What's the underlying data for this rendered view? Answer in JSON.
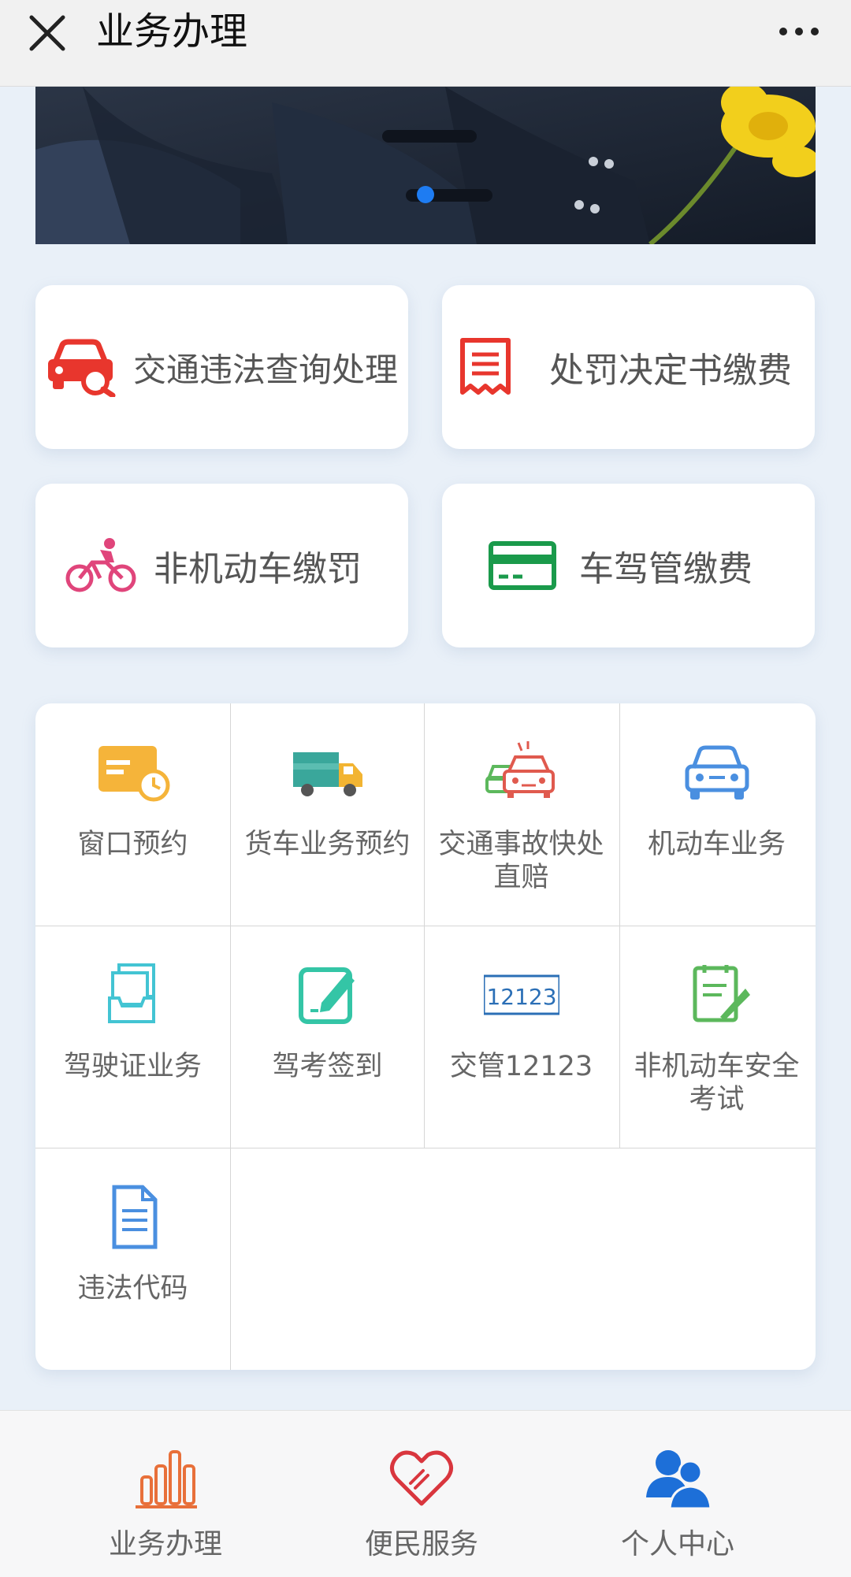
{
  "header": {
    "title": "业务办理",
    "close_icon": "close-icon",
    "more_icon": "more-icon"
  },
  "banner": {
    "carousel_pages": 1,
    "active_page": 1
  },
  "quick_cards": [
    {
      "label": "交通违法查询处理",
      "icon": "car-search-icon",
      "color": "#e8362d"
    },
    {
      "label": "处罚决定书缴费",
      "icon": "receipt-icon",
      "color": "#e8362d"
    },
    {
      "label": "非机动车缴罚",
      "icon": "bicycle-icon",
      "color": "#e0457b"
    },
    {
      "label": "车驾管缴费",
      "icon": "bank-card-icon",
      "color": "#1a9a4b"
    }
  ],
  "services": [
    {
      "label": "窗口预约",
      "icon": "window-appointment-icon"
    },
    {
      "label": "货车业务预约",
      "icon": "truck-icon"
    },
    {
      "label": "交通事故快处直赔",
      "icon": "accident-icon"
    },
    {
      "label": "机动车业务",
      "icon": "motor-vehicle-icon"
    },
    {
      "label": "驾驶证业务",
      "icon": "license-icon"
    },
    {
      "label": "驾考签到",
      "icon": "sign-in-edit-icon"
    },
    {
      "label": "交管12123",
      "icon": "app-12123-icon"
    },
    {
      "label": "非机动车安全考试",
      "icon": "exam-icon"
    },
    {
      "label": "违法代码",
      "icon": "document-icon"
    }
  ],
  "icon_text": {
    "app12123": "12123"
  },
  "bottom_nav": [
    {
      "label": "业务办理",
      "icon": "bar-chart-icon",
      "color": "#e8703a",
      "active": true
    },
    {
      "label": "便民服务",
      "icon": "heart-icon",
      "color": "#d9363e",
      "active": false
    },
    {
      "label": "个人中心",
      "icon": "users-icon",
      "color": "#1d6fd8",
      "active": false
    }
  ]
}
